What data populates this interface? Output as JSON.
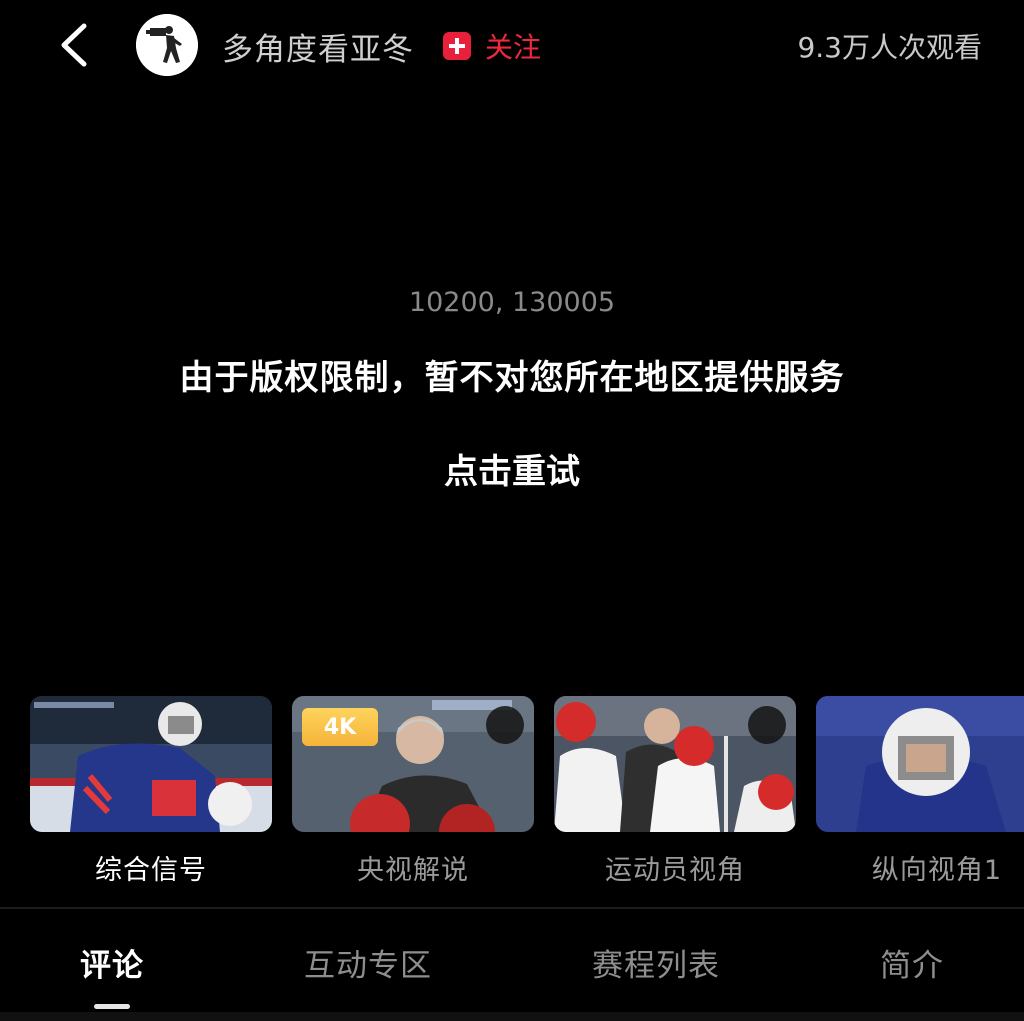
{
  "header": {
    "channel_name": "多角度看亚冬",
    "follow_label": "关注",
    "view_count": "9.3万人次观看"
  },
  "error": {
    "code": "10200, 130005",
    "message": "由于版权限制，暂不对您所在地区提供服务",
    "retry_label": "点击重试"
  },
  "cameras": [
    {
      "label": "综合信号",
      "active": true
    },
    {
      "label": "央视解说",
      "badge": "4K",
      "add": true
    },
    {
      "label": "运动员视角",
      "add": true
    },
    {
      "label": "纵向视角1"
    }
  ],
  "tabs": [
    {
      "label": "评论",
      "active": true
    },
    {
      "label": "互动专区"
    },
    {
      "label": "赛程列表"
    },
    {
      "label": "简介"
    }
  ],
  "colors": {
    "background": "#000000",
    "accent_red": "#f0283f",
    "badge_4k": "#f5b43a"
  },
  "icons": {
    "back": "chevron-left-icon",
    "follow": "plus-icon",
    "add": "plus-icon"
  }
}
